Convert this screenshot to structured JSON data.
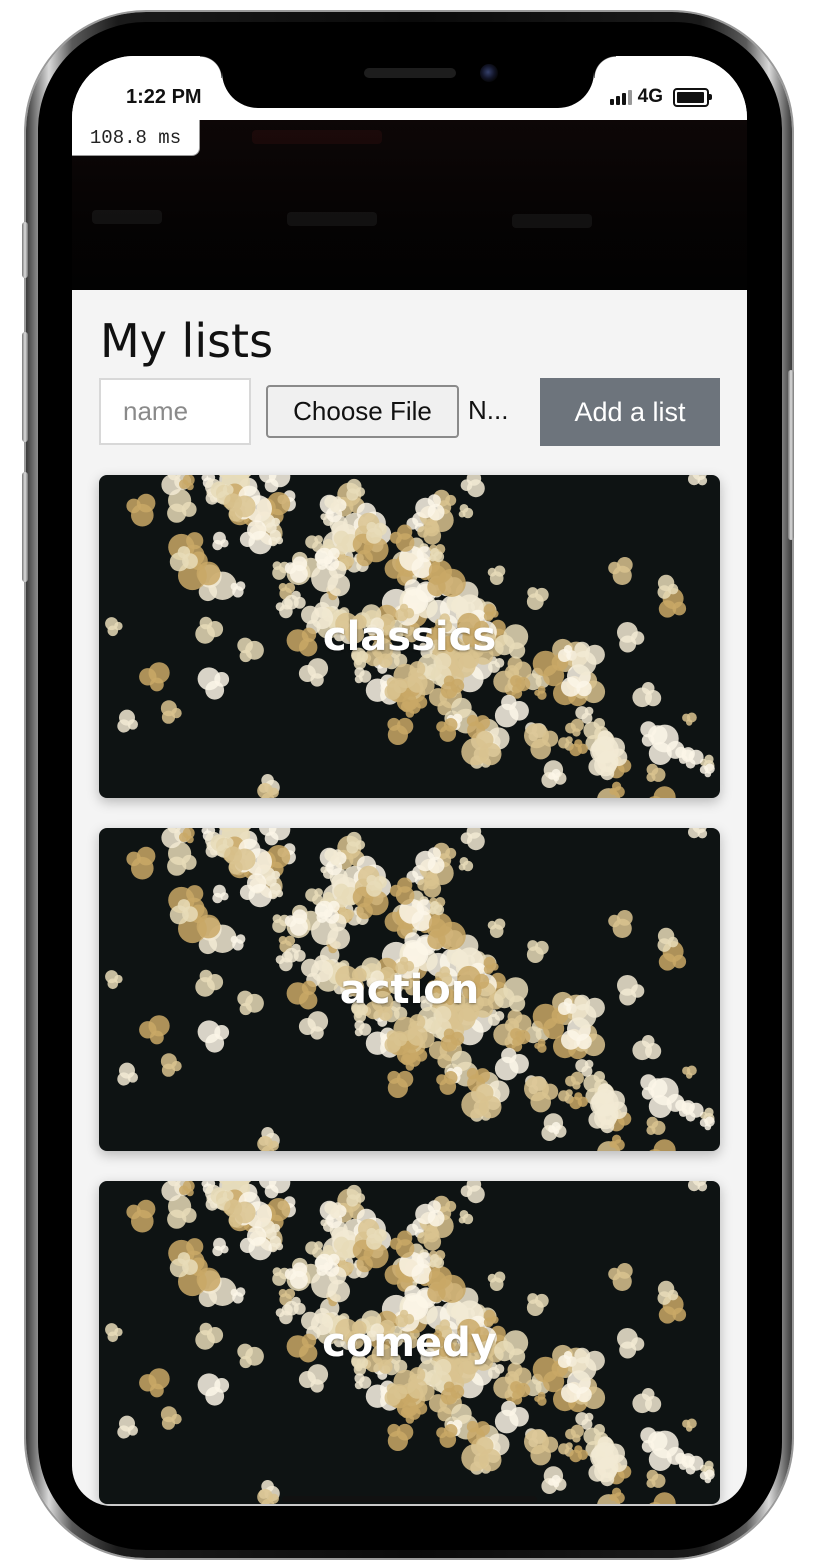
{
  "status_bar": {
    "time": "1:22 PM",
    "network": "4G",
    "signal_icon": "cellular-signal-icon",
    "battery_icon": "battery-icon"
  },
  "perf_overlay": {
    "text": "108.8 ms"
  },
  "page": {
    "title": "My lists"
  },
  "form": {
    "name_placeholder": "name",
    "file_button_label": "Choose File",
    "file_name": "N...",
    "add_button_label": "Add a list"
  },
  "lists": [
    {
      "label": "classics"
    },
    {
      "label": "action"
    },
    {
      "label": "comedy"
    }
  ],
  "colors": {
    "add_button_bg": "#6d747c",
    "page_bg": "#f4f4f4",
    "card_bg": "#0e1313",
    "popcorn": "#efe6cc"
  }
}
